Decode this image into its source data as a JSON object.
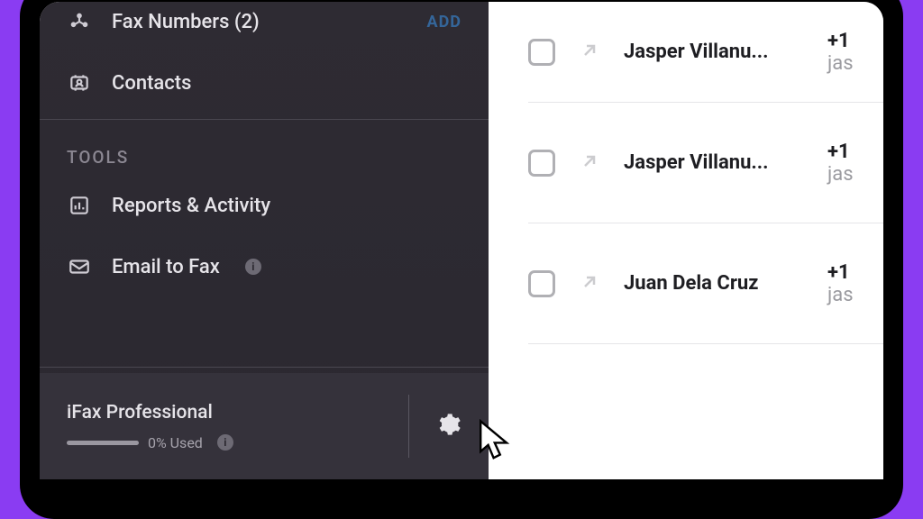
{
  "sidebar": {
    "fax_numbers": {
      "label": "Fax Numbers (2)",
      "action": "ADD"
    },
    "contacts": {
      "label": "Contacts"
    },
    "section_tools": "TOOLS",
    "reports": {
      "label": "Reports & Activity"
    },
    "email_to_fax": {
      "label": "Email to Fax"
    }
  },
  "plan": {
    "name": "iFax Professional",
    "usage_text": "0% Used"
  },
  "contacts": [
    {
      "name": "Jasper Villanu...",
      "phone_prefix": "+1",
      "sub": "jas"
    },
    {
      "name": "Jasper Villanu...",
      "phone_prefix": "+1",
      "sub": "jas"
    },
    {
      "name": "Juan Dela Cruz",
      "phone_prefix": "+1",
      "sub": "jas"
    }
  ]
}
